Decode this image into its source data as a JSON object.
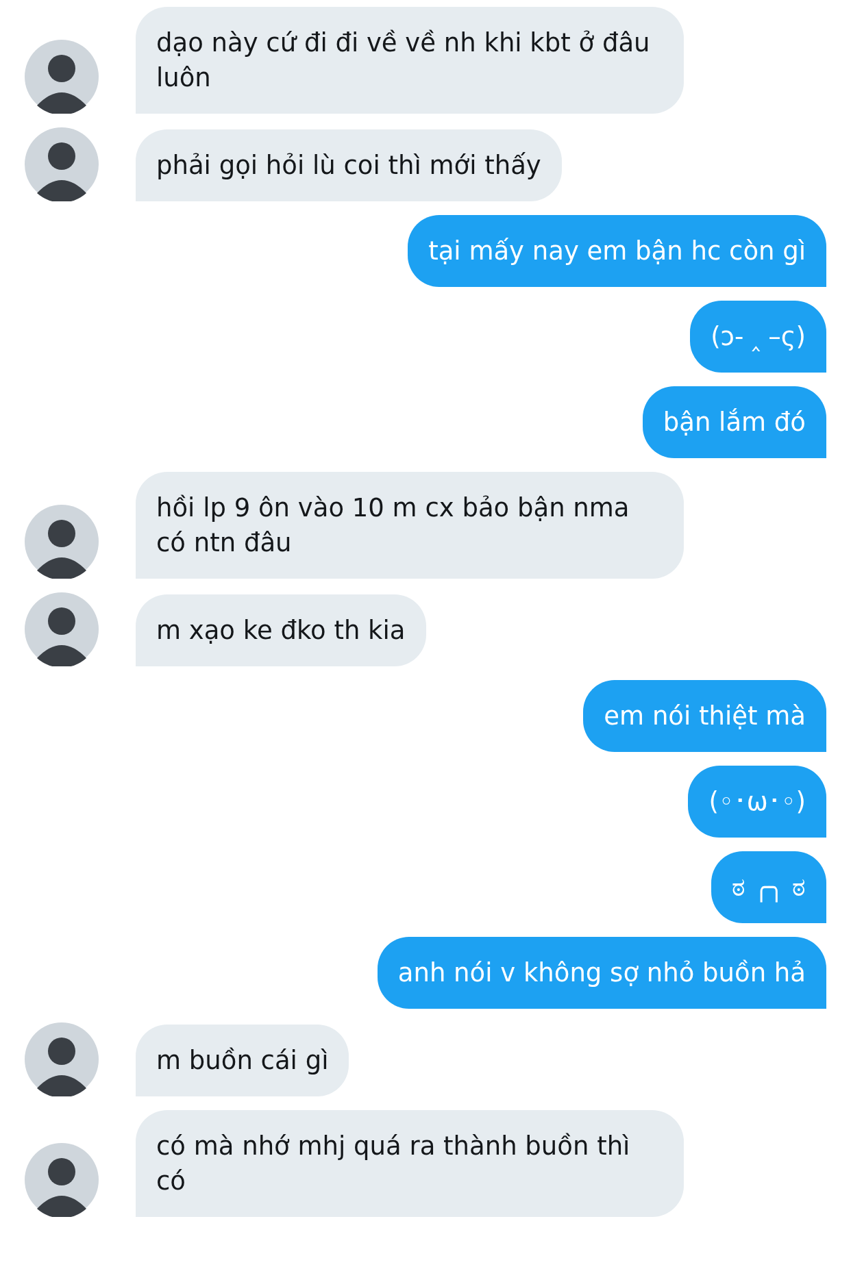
{
  "messages": [
    {
      "kind": "incoming",
      "text": "dạo này cứ đi đi về về nh khi kbt ở đâu luôn"
    },
    {
      "kind": "incoming",
      "text": "phải gọi hỏi lù coi thì mới thấy"
    },
    {
      "kind": "outgoing",
      "text": "tại mấy nay em bận hc còn gì"
    },
    {
      "kind": "outgoing",
      "text": "(ɔ- ‸ –ς)"
    },
    {
      "kind": "outgoing",
      "text": "bận lắm đó"
    },
    {
      "kind": "incoming",
      "text": "hồi lp 9 ôn vào 10 m cx bảo bận nma có ntn đâu"
    },
    {
      "kind": "incoming",
      "text": "m xạo ke đko th kia"
    },
    {
      "kind": "outgoing",
      "text": "em nói thiệt mà"
    },
    {
      "kind": "outgoing",
      "text": "(◦･ω･◦)"
    },
    {
      "kind": "outgoing",
      "text": "ಠ ╭╮ ಠ"
    },
    {
      "kind": "outgoing",
      "text": "anh nói v không sợ nhỏ buồn hả"
    },
    {
      "kind": "incoming",
      "text": "m buồn cái gì"
    },
    {
      "kind": "incoming",
      "text": "có mà nhớ mhj quá ra thành buồn thì có"
    }
  ]
}
